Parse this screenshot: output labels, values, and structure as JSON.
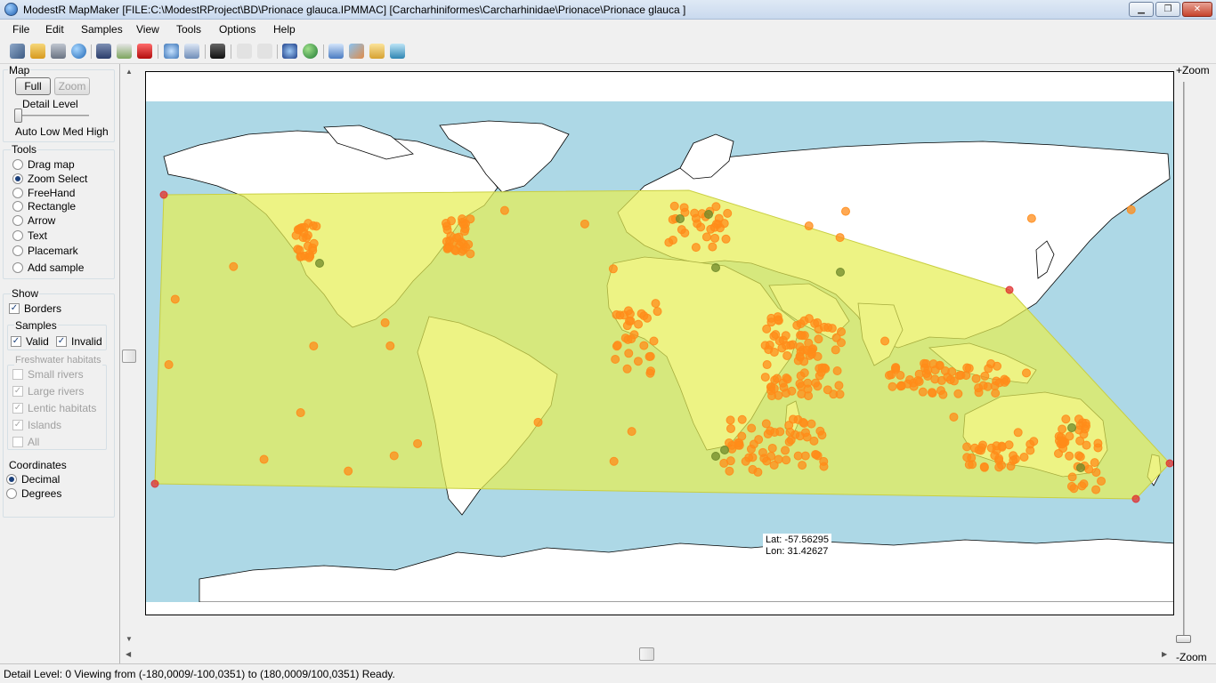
{
  "window": {
    "title": "ModestR MapMaker [FILE:C:\\ModestRProject\\BD\\Prionace glauca.IPMMAC] [Carcharhiniformes\\Carcharhinidae\\Prionace\\Prionace glauca ]",
    "minimize": "▁",
    "maximize": "❐",
    "close": "✕"
  },
  "menu": [
    "File",
    "Edit",
    "Samples",
    "View",
    "Tools",
    "Options",
    "Help"
  ],
  "map_panel": {
    "group_label": "Map",
    "full_button": "Full",
    "zoom_button": "Zoom",
    "detail_label": "Detail Level",
    "detail_scale": "Auto Low Med High",
    "detail_value": 0
  },
  "tools": {
    "group_label": "Tools",
    "items": [
      "Drag map",
      "Zoom Select",
      "FreeHand",
      "Rectangle",
      "Arrow",
      "Text",
      "Placemark",
      "Add sample"
    ],
    "selected": "Zoom Select"
  },
  "show": {
    "group_label": "Show",
    "borders_label": "Borders",
    "borders_checked": true,
    "samples_label": "Samples",
    "valid_label": "Valid",
    "valid_checked": true,
    "invalid_label": "Invalid",
    "invalid_checked": true,
    "freshwater_label": "Freshwater habitats",
    "freshwater_items": [
      {
        "label": "Small rivers",
        "checked": false
      },
      {
        "label": "Large rivers",
        "checked": true
      },
      {
        "label": "Lentic habitats",
        "checked": true
      },
      {
        "label": "Islands",
        "checked": true
      },
      {
        "label": "All",
        "checked": false
      }
    ]
  },
  "coordinates": {
    "group_label": "Coordinates",
    "decimal_label": "Decimal",
    "degrees_label": "Degrees",
    "selected": "Decimal"
  },
  "zoom": {
    "plus_label": "+Zoom",
    "minus_label": "-Zoom"
  },
  "cursor": {
    "lat_text": "Lat: -57.56295",
    "lon_text": "Lon: 31.42627"
  },
  "status": {
    "text": "Detail Level: 0   Viewing from (-180,0009/-100,0351) to (180,0009/100,0351)   Ready."
  },
  "colors": {
    "ocean": "#add8e6",
    "land": "#ffffff",
    "polygon": "#e6ee55",
    "sample": "#ff8c1a",
    "sample_dark": "#6f8a2a",
    "sample_invalid": "#e03030"
  },
  "icons": [
    "new-map-icon",
    "open-icon",
    "print-icon",
    "globe-icon",
    "save-icon",
    "export-icon",
    "save-red-icon",
    "query-icon",
    "edit-icon",
    "camera-icon",
    "undo-icon",
    "redo-icon",
    "search-map-icon",
    "world-icon",
    "refresh-icon",
    "layers-icon",
    "folder-icon",
    "import-icon"
  ]
}
